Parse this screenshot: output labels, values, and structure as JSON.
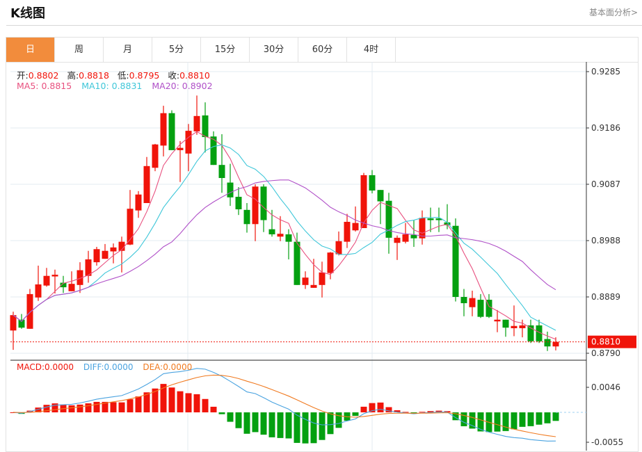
{
  "header": {
    "title": "K线图",
    "more_link": "基本面分析>"
  },
  "tabs": [
    {
      "label": "日",
      "active": true
    },
    {
      "label": "周",
      "active": false
    },
    {
      "label": "月",
      "active": false
    },
    {
      "label": "5分",
      "active": false
    },
    {
      "label": "15分",
      "active": false
    },
    {
      "label": "30分",
      "active": false
    },
    {
      "label": "60分",
      "active": false
    },
    {
      "label": "4时",
      "active": false
    }
  ],
  "ohlc_legend": {
    "open_label": "开:",
    "open": "0.8802",
    "high_label": "高:",
    "high": "0.8818",
    "low_label": "低:",
    "low": "0.8795",
    "close_label": "收:",
    "close": "0.8810"
  },
  "ma_legend": {
    "ma5": "MA5: 0.8815",
    "ma10": "MA10: 0.8831",
    "ma20": "MA20: 0.8902"
  },
  "macd_legend": {
    "macd": "MACD:0.0000",
    "diff": "DIFF:0.0000",
    "dea": "DEA:0.0000"
  },
  "colors": {
    "up": "#f0140a",
    "down": "#04a010",
    "ma5": "#e8507f",
    "ma10": "#3fc7d9",
    "ma20": "#b050c8",
    "diff": "#4aa3e0",
    "dea": "#f07a20",
    "tab_active": "#f28c3c"
  },
  "chart_data": {
    "type": "candlestick",
    "price_axis": {
      "ticks": [
        "0.9285",
        "0.9186",
        "0.9087",
        "0.8988",
        "0.8889",
        "0.8790"
      ],
      "range": [
        0.879,
        0.9285
      ]
    },
    "current_price": "0.8810",
    "macd_axis": {
      "ticks": [
        "0.0046",
        "-0.0055"
      ],
      "range": [
        -0.0055,
        0.0046
      ]
    },
    "candles": [
      [
        0.883,
        0.8863,
        0.8796,
        0.8857
      ],
      [
        0.8849,
        0.8859,
        0.8833,
        0.8835
      ],
      [
        0.8833,
        0.8903,
        0.8833,
        0.8894
      ],
      [
        0.8888,
        0.8944,
        0.8882,
        0.8911
      ],
      [
        0.8909,
        0.894,
        0.8907,
        0.8926
      ],
      [
        0.8925,
        0.8937,
        0.8895,
        0.8928
      ],
      [
        0.8914,
        0.8926,
        0.8896,
        0.8906
      ],
      [
        0.8899,
        0.8934,
        0.8899,
        0.8912
      ],
      [
        0.891,
        0.895,
        0.8896,
        0.8936
      ],
      [
        0.8926,
        0.897,
        0.8914,
        0.8955
      ],
      [
        0.895,
        0.8977,
        0.8944,
        0.8973
      ],
      [
        0.8956,
        0.8982,
        0.8956,
        0.897
      ],
      [
        0.8969,
        0.8983,
        0.8948,
        0.8976
      ],
      [
        0.897,
        0.8995,
        0.8932,
        0.8986
      ],
      [
        0.8981,
        0.9077,
        0.898,
        0.9044
      ],
      [
        0.9041,
        0.9075,
        0.9028,
        0.9069
      ],
      [
        0.9054,
        0.9135,
        0.9054,
        0.9119
      ],
      [
        0.9116,
        0.9158,
        0.911,
        0.9157
      ],
      [
        0.9155,
        0.9225,
        0.9136,
        0.9212
      ],
      [
        0.9212,
        0.9217,
        0.9147,
        0.9147
      ],
      [
        0.9147,
        0.9163,
        0.9091,
        0.9151
      ],
      [
        0.9141,
        0.9193,
        0.911,
        0.9181
      ],
      [
        0.918,
        0.9243,
        0.9174,
        0.9207
      ],
      [
        0.9208,
        0.9231,
        0.9143,
        0.917
      ],
      [
        0.9171,
        0.918,
        0.9121,
        0.9121
      ],
      [
        0.9121,
        0.9175,
        0.9072,
        0.9098
      ],
      [
        0.909,
        0.9123,
        0.9049,
        0.9064
      ],
      [
        0.9065,
        0.9082,
        0.9033,
        0.9043
      ],
      [
        0.9042,
        0.9054,
        0.9002,
        0.9017
      ],
      [
        0.9017,
        0.9087,
        0.8987,
        0.9083
      ],
      [
        0.9083,
        0.9087,
        0.9003,
        0.9024
      ],
      [
        0.9008,
        0.9042,
        0.8995,
        0.8999
      ],
      [
        0.8995,
        0.9031,
        0.8987,
        0.9
      ],
      [
        0.8999,
        0.9008,
        0.8955,
        0.8986
      ],
      [
        0.8986,
        0.9002,
        0.891,
        0.891
      ],
      [
        0.891,
        0.8934,
        0.8903,
        0.8923
      ],
      [
        0.8905,
        0.8956,
        0.8905,
        0.891
      ],
      [
        0.891,
        0.8951,
        0.8888,
        0.8932
      ],
      [
        0.8931,
        0.8968,
        0.892,
        0.8967
      ],
      [
        0.8964,
        0.9004,
        0.8962,
        0.8987
      ],
      [
        0.8986,
        0.9035,
        0.8975,
        0.9021
      ],
      [
        0.9006,
        0.9048,
        0.9004,
        0.9019
      ],
      [
        0.901,
        0.9107,
        0.901,
        0.9103
      ],
      [
        0.9103,
        0.9112,
        0.9071,
        0.9076
      ],
      [
        0.9077,
        0.9077,
        0.9017,
        0.9057
      ],
      [
        0.9058,
        0.9072,
        0.8965,
        0.8993
      ],
      [
        0.8984,
        0.8997,
        0.8954,
        0.8993
      ],
      [
        0.8986,
        0.9019,
        0.8983,
        0.8999
      ],
      [
        0.8998,
        0.9024,
        0.8977,
        0.8992
      ],
      [
        0.8992,
        0.9041,
        0.8981,
        0.9028
      ],
      [
        0.9027,
        0.9046,
        0.9003,
        0.9024
      ],
      [
        0.9027,
        0.9046,
        0.9003,
        0.9024
      ],
      [
        0.902,
        0.9052,
        0.9008,
        0.9015
      ],
      [
        0.9014,
        0.9027,
        0.8881,
        0.8889
      ],
      [
        0.8889,
        0.8903,
        0.8855,
        0.8878
      ],
      [
        0.8871,
        0.89,
        0.8855,
        0.8887
      ],
      [
        0.8884,
        0.8894,
        0.8852,
        0.8854
      ],
      [
        0.8884,
        0.8894,
        0.8852,
        0.8854
      ],
      [
        0.8846,
        0.8866,
        0.8827,
        0.8849
      ],
      [
        0.8849,
        0.8849,
        0.8819,
        0.8835
      ],
      [
        0.8834,
        0.8874,
        0.882,
        0.8838
      ],
      [
        0.8834,
        0.8849,
        0.8818,
        0.8839
      ],
      [
        0.8839,
        0.8849,
        0.8808,
        0.8811
      ],
      [
        0.8839,
        0.8849,
        0.8808,
        0.8811
      ],
      [
        0.8815,
        0.8828,
        0.8794,
        0.8802
      ],
      [
        0.8802,
        0.8818,
        0.8795,
        0.881
      ]
    ],
    "candle_format": [
      "open",
      "high",
      "low",
      "close"
    ],
    "series": [
      "MA5",
      "MA10",
      "MA20",
      "DIFF",
      "DEA",
      "MACD"
    ]
  }
}
